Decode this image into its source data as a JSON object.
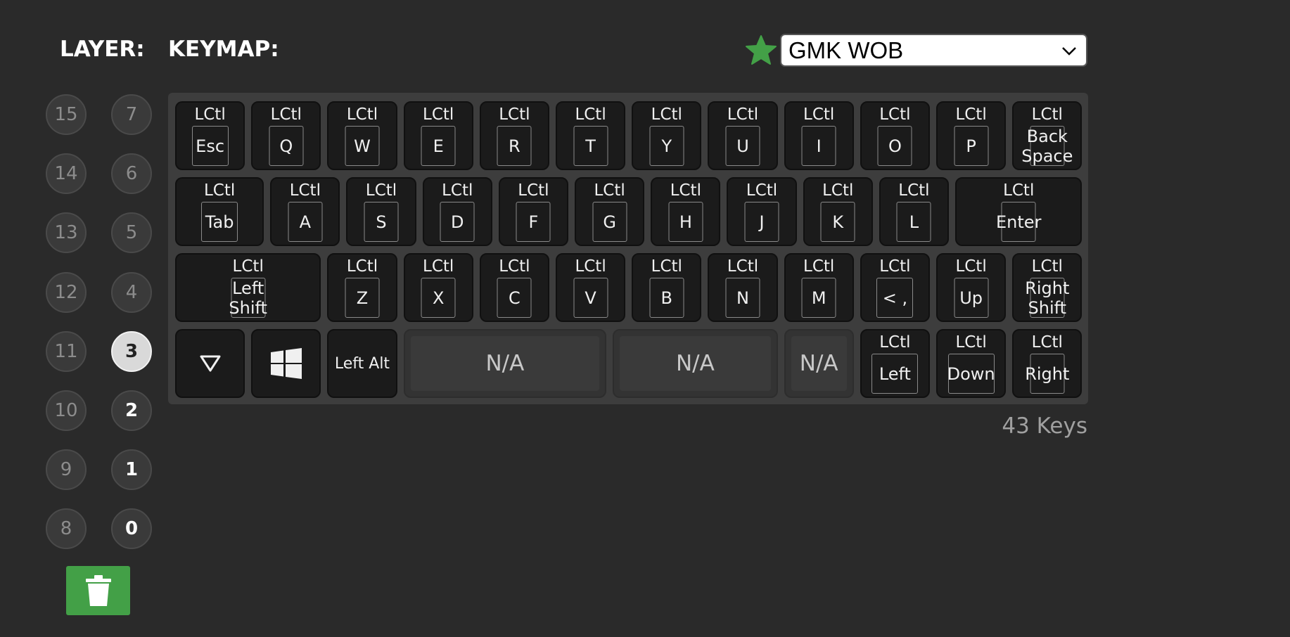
{
  "headers": {
    "layer": "LAYER:",
    "keymap": "KEYMAP:"
  },
  "layers": {
    "left": [
      "15",
      "14",
      "13",
      "12",
      "11",
      "10",
      "9",
      "8"
    ],
    "right": [
      "7",
      "6",
      "5",
      "4",
      "3",
      "2",
      "1",
      "0"
    ],
    "used": [
      "3",
      "2",
      "1",
      "0"
    ],
    "active": "3"
  },
  "profile": {
    "selected": "GMK WOB",
    "favorite_color": "#43a047"
  },
  "key_count": "43 Keys",
  "rows": [
    [
      {
        "mod": "LCtl",
        "label": "Esc"
      },
      {
        "mod": "LCtl",
        "label": "Q"
      },
      {
        "mod": "LCtl",
        "label": "W"
      },
      {
        "mod": "LCtl",
        "label": "E"
      },
      {
        "mod": "LCtl",
        "label": "R"
      },
      {
        "mod": "LCtl",
        "label": "T"
      },
      {
        "mod": "LCtl",
        "label": "Y"
      },
      {
        "mod": "LCtl",
        "label": "U"
      },
      {
        "mod": "LCtl",
        "label": "I"
      },
      {
        "mod": "LCtl",
        "label": "O"
      },
      {
        "mod": "LCtl",
        "label": "P"
      },
      {
        "mod": "LCtl",
        "label": "Back Space"
      }
    ],
    [
      {
        "mod": "LCtl",
        "label": "Tab"
      },
      {
        "mod": "LCtl",
        "label": "A"
      },
      {
        "mod": "LCtl",
        "label": "S"
      },
      {
        "mod": "LCtl",
        "label": "D"
      },
      {
        "mod": "LCtl",
        "label": "F"
      },
      {
        "mod": "LCtl",
        "label": "G"
      },
      {
        "mod": "LCtl",
        "label": "H"
      },
      {
        "mod": "LCtl",
        "label": "J"
      },
      {
        "mod": "LCtl",
        "label": "K"
      },
      {
        "mod": "LCtl",
        "label": "L"
      },
      {
        "mod": "LCtl",
        "label": "Enter"
      }
    ],
    [
      {
        "mod": "LCtl",
        "label": "Left Shift"
      },
      {
        "mod": "LCtl",
        "label": "Z"
      },
      {
        "mod": "LCtl",
        "label": "X"
      },
      {
        "mod": "LCtl",
        "label": "C"
      },
      {
        "mod": "LCtl",
        "label": "V"
      },
      {
        "mod": "LCtl",
        "label": "B"
      },
      {
        "mod": "LCtl",
        "label": "N"
      },
      {
        "mod": "LCtl",
        "label": "M"
      },
      {
        "mod": "LCtl",
        "label": "< ,"
      },
      {
        "mod": "LCtl",
        "label": "Up"
      },
      {
        "mod": "LCtl",
        "label": "Right Shift"
      }
    ],
    [
      {
        "icon": "triangle-down-icon"
      },
      {
        "icon": "windows-icon"
      },
      {
        "label": "Left Alt",
        "plain": true
      },
      {
        "label": "N/A",
        "na": true
      },
      {
        "label": "N/A",
        "na": true
      },
      {
        "label": "N/A",
        "na": true
      },
      {
        "mod": "LCtl",
        "label": "Left"
      },
      {
        "mod": "LCtl",
        "label": "Down"
      },
      {
        "mod": "LCtl",
        "label": "Right"
      }
    ]
  ]
}
